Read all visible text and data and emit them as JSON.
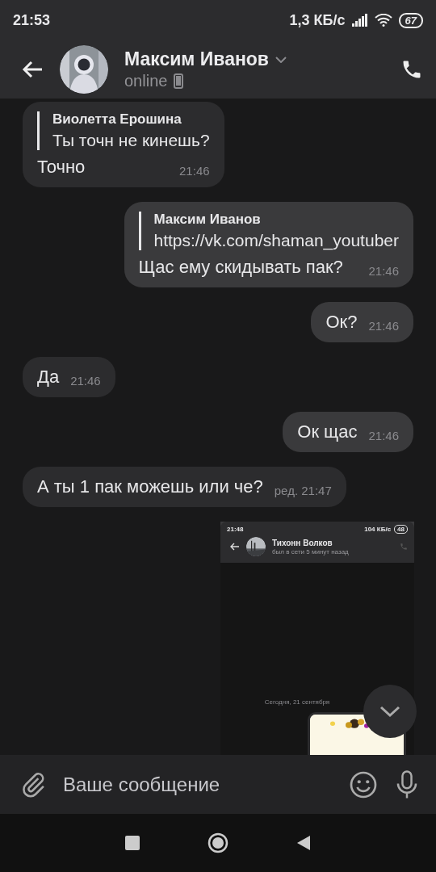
{
  "status_bar": {
    "time": "21:53",
    "speed": "1,3 КБ/с",
    "battery": "67"
  },
  "header": {
    "title": "Максим Иванов",
    "status": "online"
  },
  "messages": [
    {
      "kind": "text",
      "outgoing": false,
      "reply": {
        "author": "Виолетта Ерошина",
        "text": "Ты точн не кинешь?"
      },
      "text": "Точно",
      "time": "21:46"
    },
    {
      "kind": "text",
      "outgoing": true,
      "reply": {
        "author": "Максим Иванов",
        "text": "https://vk.com/shaman_youtuber"
      },
      "text": "Щас ему скидывать пак?",
      "time": "21:46"
    },
    {
      "kind": "text",
      "outgoing": true,
      "text": "Ок?",
      "time": "21:46"
    },
    {
      "kind": "text",
      "outgoing": false,
      "text": "Да",
      "time": "21:46"
    },
    {
      "kind": "text",
      "outgoing": true,
      "text": "Ок щас",
      "time": "21:46"
    },
    {
      "kind": "text",
      "outgoing": false,
      "text": "А ты 1 пак можешь или че?",
      "time": "ред. 21:47"
    },
    {
      "kind": "screenshot",
      "outgoing": true,
      "shot": {
        "time": "21:48",
        "speed": "104 КБ/с",
        "battery": "48",
        "title": "Тихонн Волков",
        "status": "был в сети 5 минут назад",
        "date_label": "Сегодня, 21 сентября"
      }
    }
  ],
  "composer": {
    "placeholder": "Ваше сообщение"
  }
}
